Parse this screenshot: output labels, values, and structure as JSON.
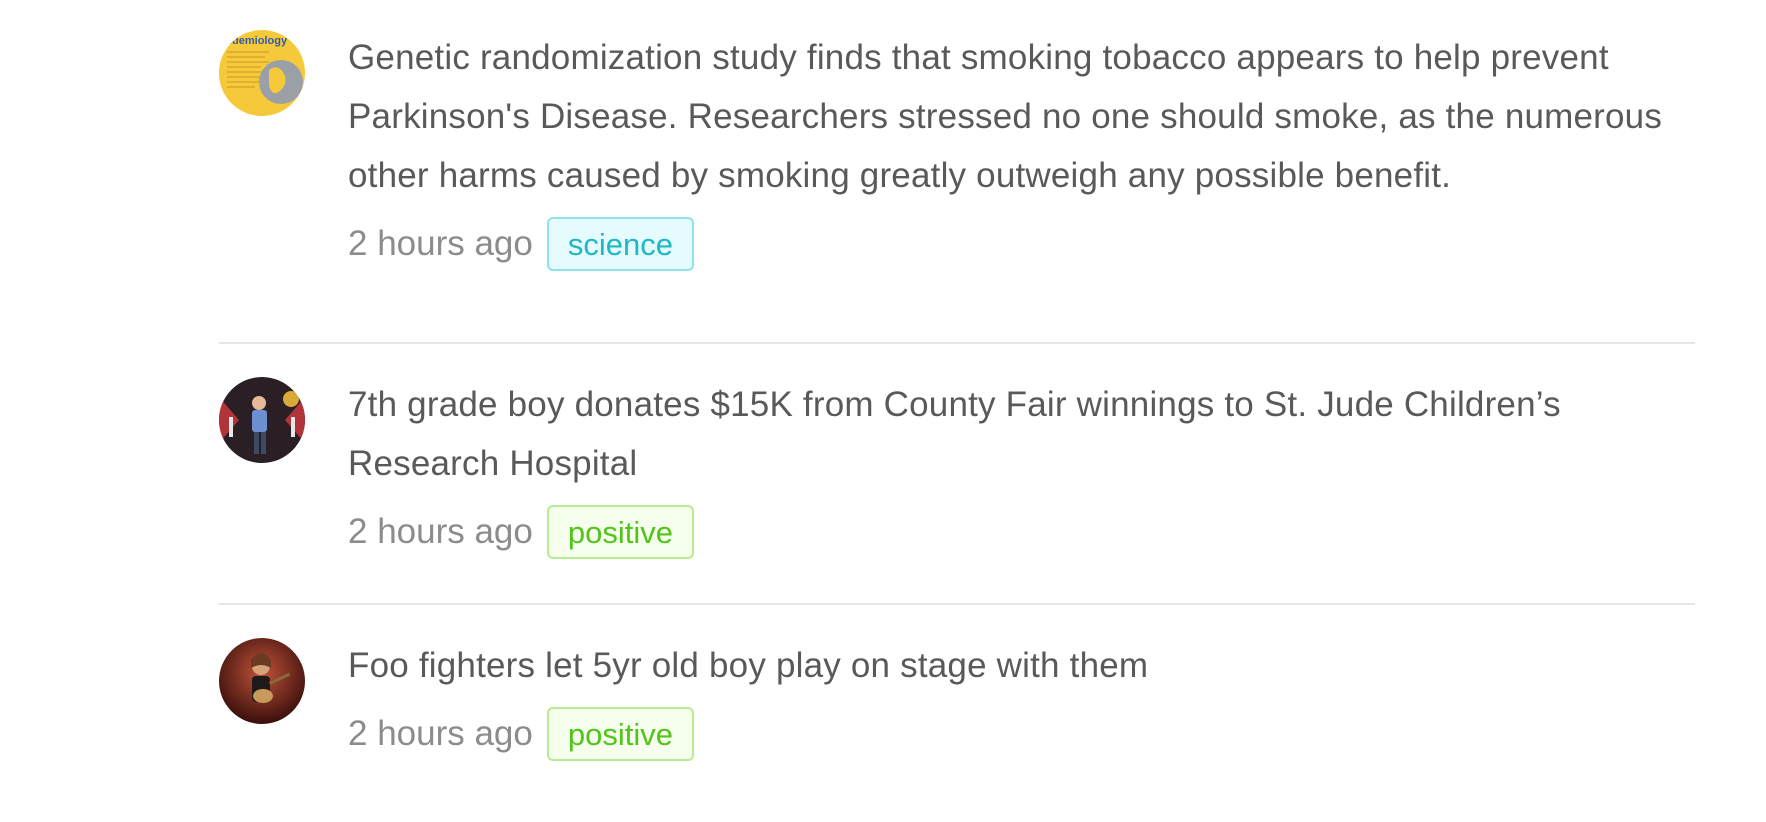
{
  "feed": {
    "items": [
      {
        "avatar_icon": "journal-cover-avatar",
        "title": "Genetic randomization study finds that smoking tobacco appears to help prevent Parkinson's Disease. Researchers stressed no one should smoke, as the numerous other harms caused by smoking greatly outweigh any possible benefit.",
        "avatar_text": "idemiology",
        "time": "2 hours ago",
        "tag": "science",
        "tag_color": "#1fb8c5"
      },
      {
        "avatar_icon": "boy-on-stage-avatar",
        "title": "7th grade boy donates $15K from County Fair winnings to St. Jude Children’s Research Hospital",
        "time": "2 hours ago",
        "tag": "positive",
        "tag_color": "#52c41a"
      },
      {
        "avatar_icon": "guitarist-avatar",
        "title": "Foo fighters let 5yr old boy play on stage with them",
        "time": "2 hours ago",
        "tag": "positive",
        "tag_color": "#52c41a"
      }
    ]
  }
}
